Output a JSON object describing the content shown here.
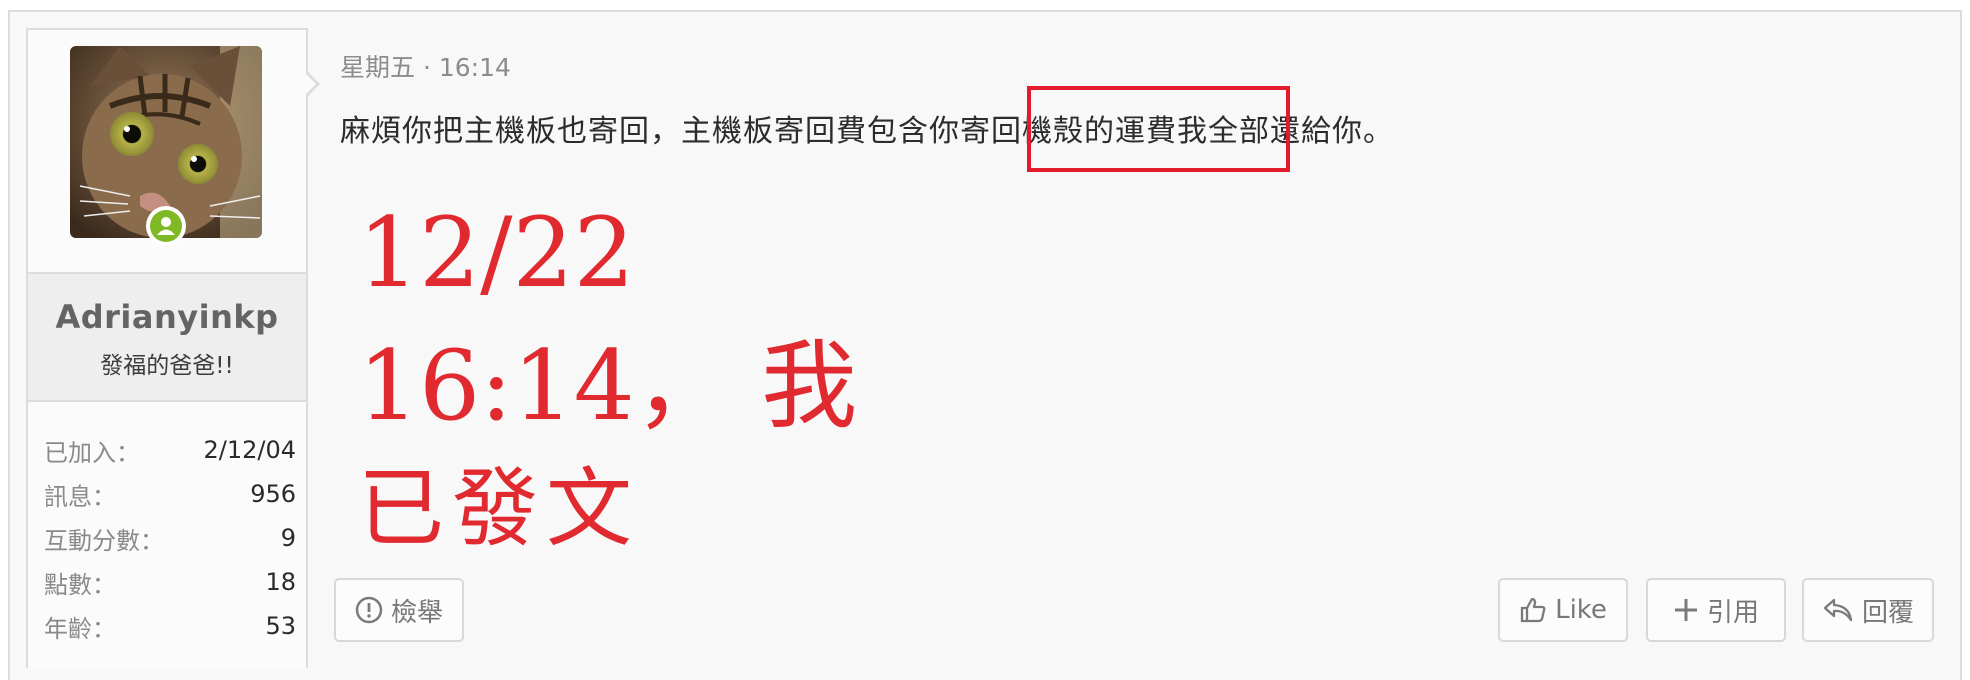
{
  "user": {
    "name": "Adrianyinkp",
    "title": "發福的爸爸!!",
    "avatar": "cat-avatar",
    "online_icon": "user-online-icon",
    "stats": [
      {
        "label": "已加入：",
        "value": "2/12/04"
      },
      {
        "label": "訊息：",
        "value": "956"
      },
      {
        "label": "互動分數：",
        "value": "9"
      },
      {
        "label": "點數：",
        "value": "18"
      },
      {
        "label": "年齡：",
        "value": "53"
      }
    ]
  },
  "post": {
    "timestamp": "星期五 · 16:14",
    "text_before": "麻煩你把主機板也寄回，主機板寄回費包含你",
    "text_highlighted": "寄回機殼的運費",
    "text_after": "我全部還給你。",
    "annotation_line1": "12/22",
    "annotation_line2": "16:14， 我",
    "annotation_line3": "已發文",
    "annotation_color": "#e02a30"
  },
  "actions": {
    "report": {
      "label": "檢舉",
      "icon": "exclamation-circle-icon"
    },
    "like": {
      "label": "Like",
      "icon": "thumbs-up-icon"
    },
    "quote": {
      "label": "引用",
      "icon": "plus-icon"
    },
    "reply": {
      "label": "回覆",
      "icon": "reply-arrow-icon"
    }
  }
}
